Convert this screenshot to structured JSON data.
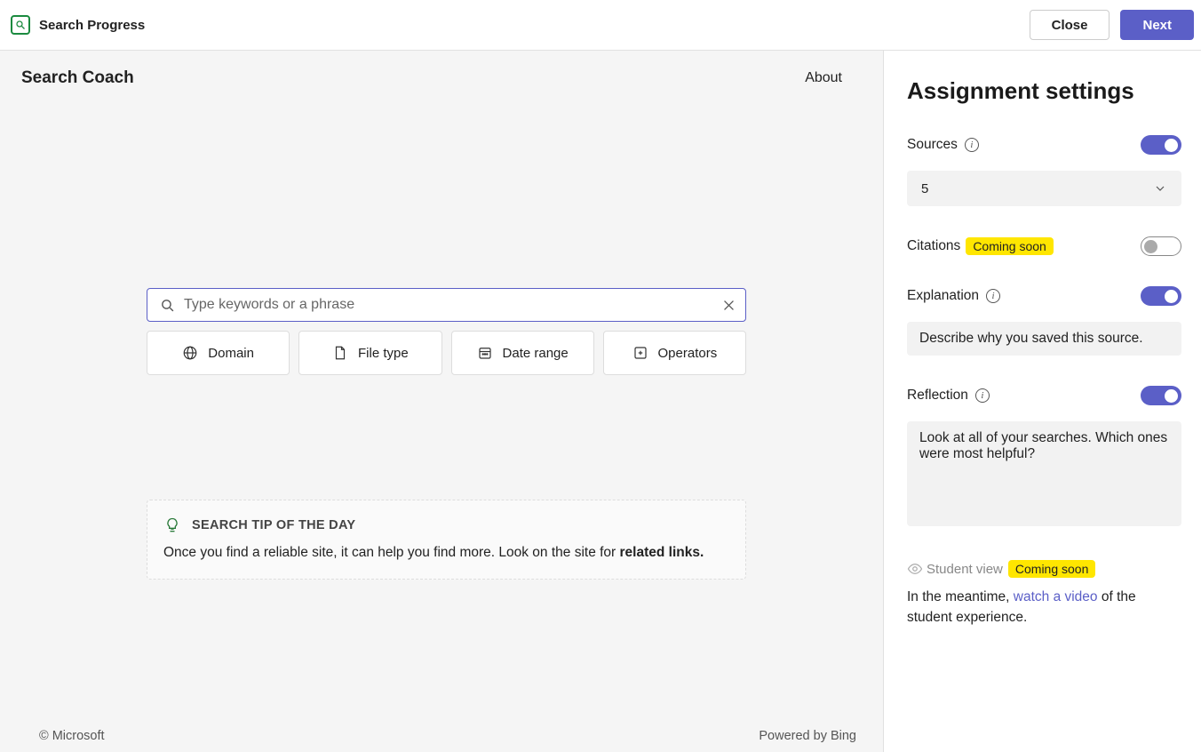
{
  "topbar": {
    "app_title": "Search Progress",
    "close_label": "Close",
    "next_label": "Next"
  },
  "main": {
    "title": "Search Coach",
    "about_label": "About",
    "search_placeholder": "Type keywords or a phrase",
    "filters": {
      "domain": "Domain",
      "file_type": "File type",
      "date_range": "Date range",
      "operators": "Operators"
    },
    "tip": {
      "title": "SEARCH TIP OF THE DAY",
      "body_prefix": "Once you find a reliable site, it can help you find more. Look on the site for ",
      "body_bold": "related links."
    },
    "footer": {
      "copyright": "© Microsoft",
      "powered": "Powered by Bing"
    }
  },
  "sidebar": {
    "title": "Assignment settings",
    "sources": {
      "label": "Sources",
      "value": "5"
    },
    "citations": {
      "label": "Citations",
      "badge": "Coming soon"
    },
    "explanation": {
      "label": "Explanation",
      "placeholder": "Describe why you saved this source."
    },
    "reflection": {
      "label": "Reflection",
      "text": "Look at all of your searches. Which ones were most helpful?"
    },
    "student_view": {
      "label": "Student view",
      "badge": "Coming soon"
    },
    "meantime": {
      "prefix": "In the meantime, ",
      "link": "watch a video",
      "suffix": " of the student experience."
    }
  }
}
